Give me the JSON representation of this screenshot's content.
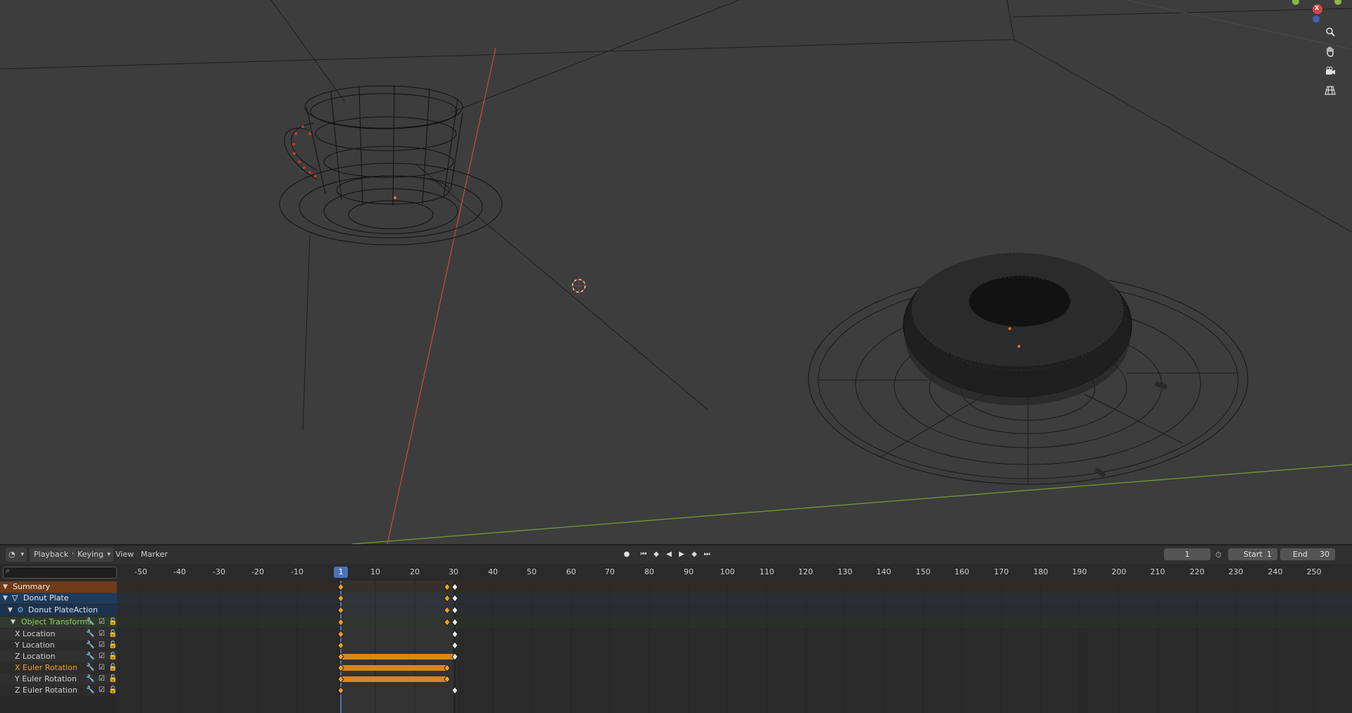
{
  "header": {
    "editor_icon": "clock-icon",
    "menus": [
      "Playback",
      "Keying",
      "View",
      "Marker"
    ],
    "current_frame": "1",
    "start_label": "Start",
    "start_value": "1",
    "end_label": "End",
    "end_value": "30"
  },
  "viewport": {
    "nav_icons": [
      "zoom-icon",
      "hand-pan-icon",
      "camera-icon",
      "grid-icon"
    ],
    "gizmo_axis_label": "X"
  },
  "ruler": {
    "ticks": [
      "-50",
      "-40",
      "-30",
      "-20",
      "-10",
      "10",
      "20",
      "30",
      "40",
      "50",
      "60",
      "70",
      "80",
      "90",
      "100",
      "110",
      "120",
      "130",
      "140",
      "150",
      "160",
      "170",
      "180",
      "190",
      "200",
      "210",
      "220",
      "230",
      "240",
      "250"
    ],
    "current": "1"
  },
  "channels": {
    "summary": "Summary",
    "object": "Donut Plate",
    "action": "Donut PlateAction",
    "group": "Object Transforms",
    "items": [
      "X Location",
      "Y Location",
      "Z Location",
      "X Euler Rotation",
      "Y Euler Rotation",
      "Z Euler Rotation"
    ]
  },
  "colors": {
    "accent": "#4b73ba",
    "keyframe_selected": "#f0a020",
    "hold_bar": "#d8861c",
    "summary_bg": "#6e3b16",
    "object_bg": "#1f3b5c",
    "group_text": "#8fd06a",
    "highlight_text": "#f0a020"
  }
}
